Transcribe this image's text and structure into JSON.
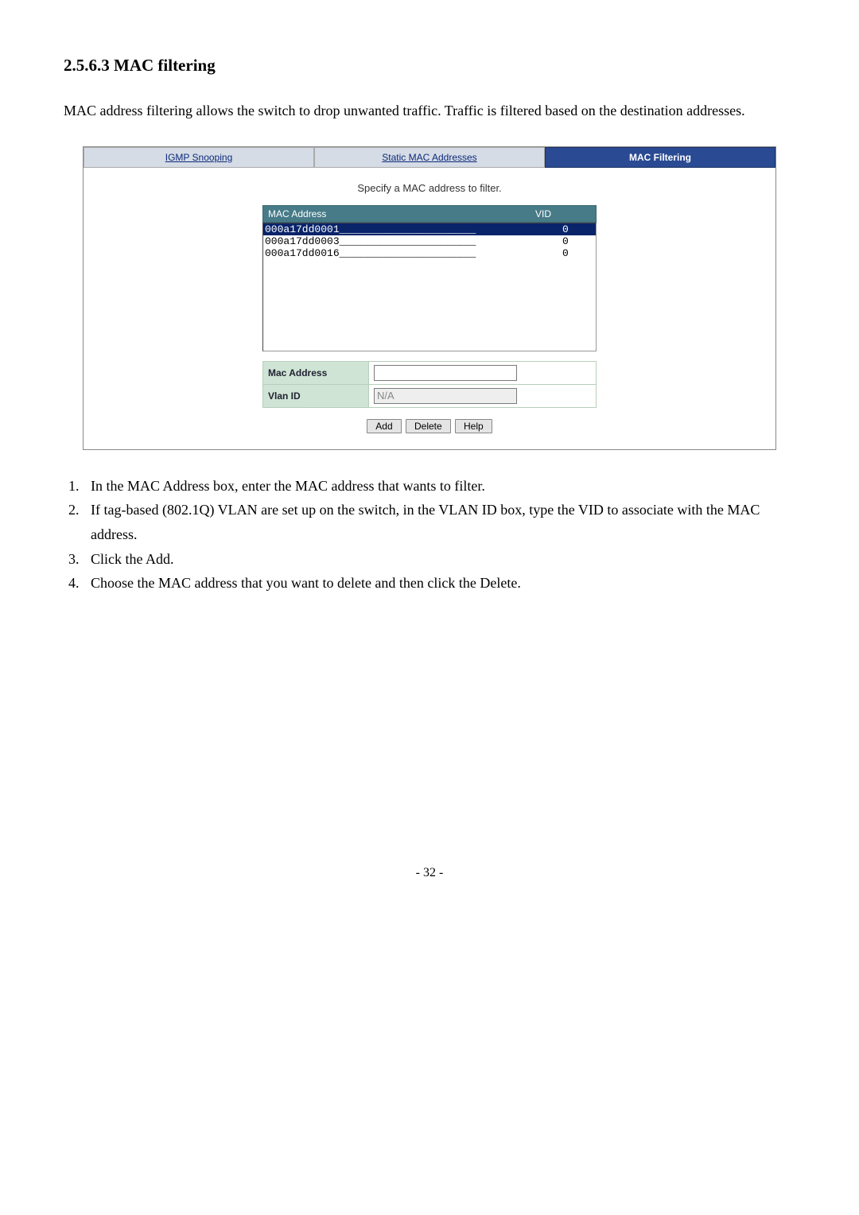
{
  "heading": "2.5.6.3 MAC filtering",
  "intro": "MAC address filtering allows the switch to drop unwanted traffic. Traffic is filtered based on the destination addresses.",
  "tabs": {
    "igmp": "IGMP Snooping",
    "static": "Static MAC Addresses",
    "filter": "MAC Filtering"
  },
  "panel": {
    "subtitle": "Specify a MAC address to filter.",
    "col_mac": "MAC Address",
    "col_vid": "VID",
    "rows": [
      {
        "mac": "000a17dd0001",
        "vid": "0",
        "selected": true
      },
      {
        "mac": "000a17dd0003",
        "vid": "0",
        "selected": false
      },
      {
        "mac": "000a17dd0016",
        "vid": "0",
        "selected": false
      }
    ],
    "form": {
      "mac_label": "Mac Address",
      "mac_value": "",
      "vlan_label": "Vlan ID",
      "vlan_value": "N/A"
    },
    "buttons": {
      "add": "Add",
      "delete": "Delete",
      "help": "Help"
    }
  },
  "instructions": [
    "In the MAC Address box, enter the MAC address that wants to filter.",
    "If tag-based (802.1Q) VLAN are set up on the switch, in the VLAN ID box, type the VID to associate with the MAC address.",
    "Click the Add.",
    "Choose the MAC address that you want to delete and then click the Delete."
  ],
  "page_number": "- 32 -"
}
